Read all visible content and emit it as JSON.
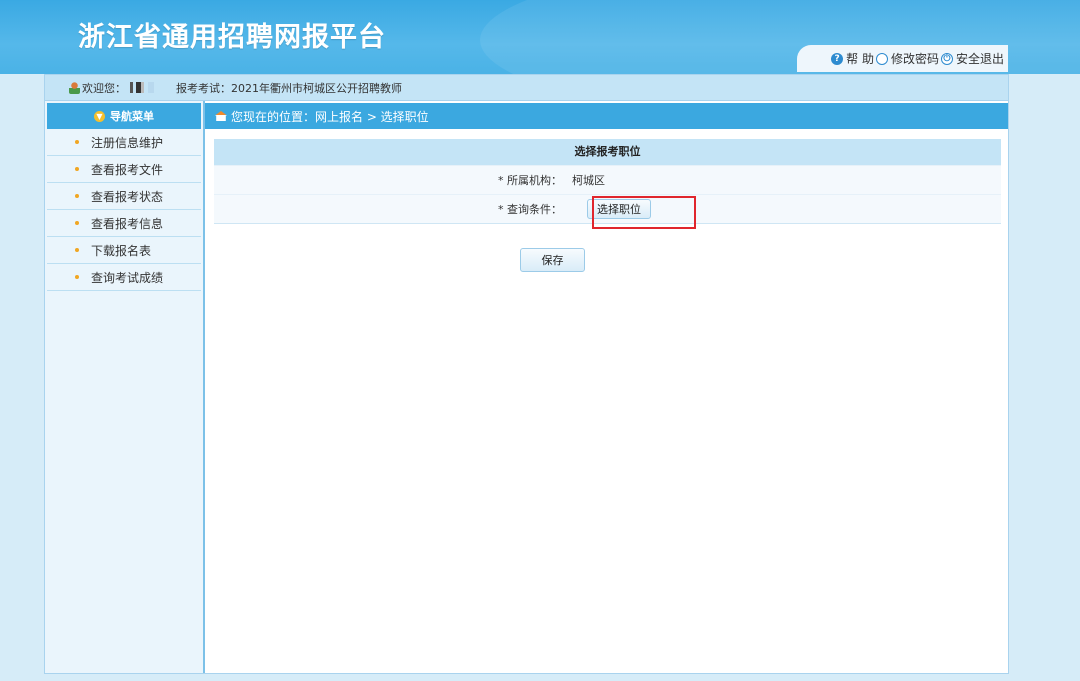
{
  "header": {
    "site_title": "浙江省通用招聘网报平台",
    "links": {
      "help": "帮 助",
      "change_password": "修改密码",
      "logout": "安全退出"
    }
  },
  "infobar": {
    "welcome": "欢迎您：",
    "exam_label": "报考考试：2021年衢州市柯城区公开招聘教师"
  },
  "sidebar": {
    "title": "导航菜单",
    "items": [
      {
        "label": "注册信息维护"
      },
      {
        "label": "查看报考文件"
      },
      {
        "label": "查看报考状态"
      },
      {
        "label": "查看报考信息"
      },
      {
        "label": "下载报名表"
      },
      {
        "label": "查询考试成绩"
      }
    ]
  },
  "breadcrumb": "您现在的位置：网上报名 > 选择职位",
  "form": {
    "title": "选择报考职位",
    "org_label": "* 所属机构：",
    "org_value": "柯城区",
    "query_label": "* 查询条件：",
    "select_button": "选择职位",
    "save_button": "保存"
  },
  "colors": {
    "header_blue": "#3ba8e0",
    "light_blue": "#c4e4f6",
    "highlight_red": "#e0262d"
  }
}
